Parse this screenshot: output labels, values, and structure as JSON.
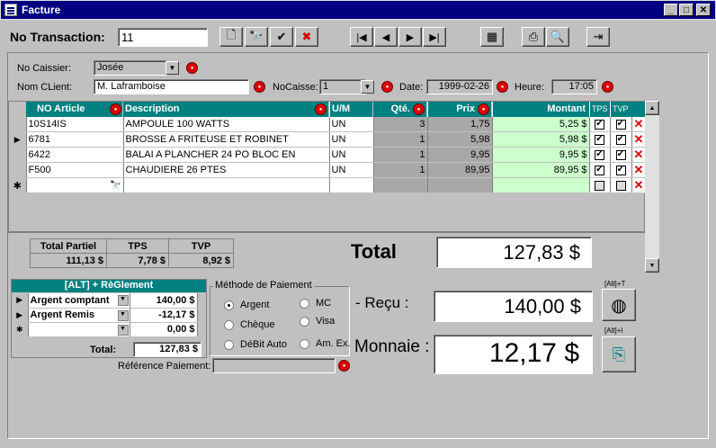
{
  "window": {
    "title": "Facture"
  },
  "header": {
    "transaction_label": "No Transaction:",
    "transaction_value": "11"
  },
  "form": {
    "caissier_label": "No Caissier:",
    "caissier_value": "Josée",
    "client_label": "Nom CLient:",
    "client_value": "M. Laframboise",
    "nocaisse_label": "NoCaisse:",
    "nocaisse_value": "1",
    "date_label": "Date:",
    "date_value": "1999-02-26",
    "heure_label": "Heure:",
    "heure_value": "17:05"
  },
  "grid": {
    "columns": [
      "NO Article",
      "Description",
      "U/M",
      "Qté.",
      "Prix",
      "Montant",
      "TPS",
      "TVP"
    ],
    "rows": [
      {
        "article": "10S14IS",
        "desc": "AMPOULE 100 WATTS",
        "um": "UN",
        "qty": "3",
        "prix": "1,75",
        "montant": "5,25 $",
        "tps": true,
        "tvp": true
      },
      {
        "article": "6781",
        "desc": "BROSSE A FRITEUSE ET ROBINET",
        "um": "UN",
        "qty": "1",
        "prix": "5,98",
        "montant": "5,98 $",
        "tps": true,
        "tvp": true
      },
      {
        "article": "6422",
        "desc": "BALAI A PLANCHER 24 PO BLOC EN",
        "um": "UN",
        "qty": "1",
        "prix": "9,95",
        "montant": "9,95 $",
        "tps": true,
        "tvp": true
      },
      {
        "article": "F500",
        "desc": "CHAUDIERE 26 PTES",
        "um": "UN",
        "qty": "1",
        "prix": "89,95",
        "montant": "89,95 $",
        "tps": true,
        "tvp": true
      }
    ]
  },
  "summary": {
    "partiel_label": "Total Partiel",
    "partiel": "111,13 $",
    "tps_label": "TPS",
    "tps": "7,78 $",
    "tvp_label": "TVP",
    "tvp": "8,92 $",
    "total_label": "Total",
    "total": "127,83 $"
  },
  "reglement": {
    "title": "[ALT] + RèGlement",
    "rows": [
      {
        "type": "Argent comptant",
        "amount": "140,00 $"
      },
      {
        "type": "Argent Remis",
        "amount": "-12,17 $"
      },
      {
        "type": "",
        "amount": "0,00 $"
      }
    ],
    "total_label": "Total:",
    "total": "127,83 $",
    "ref_label": "Référence Paiement:"
  },
  "paiement": {
    "title": "Méthode de Paiement",
    "options": [
      "Argent",
      "Chèque",
      "DéBit Auto",
      "MC",
      "Visa",
      "Am. Ex."
    ]
  },
  "recu": {
    "label": "- Reçu :",
    "value": "140,00 $",
    "alt": "[Alt]+T"
  },
  "monnaie": {
    "label": "Monnaie :",
    "value": "12,17 $",
    "alt": "[Alt]+I"
  }
}
